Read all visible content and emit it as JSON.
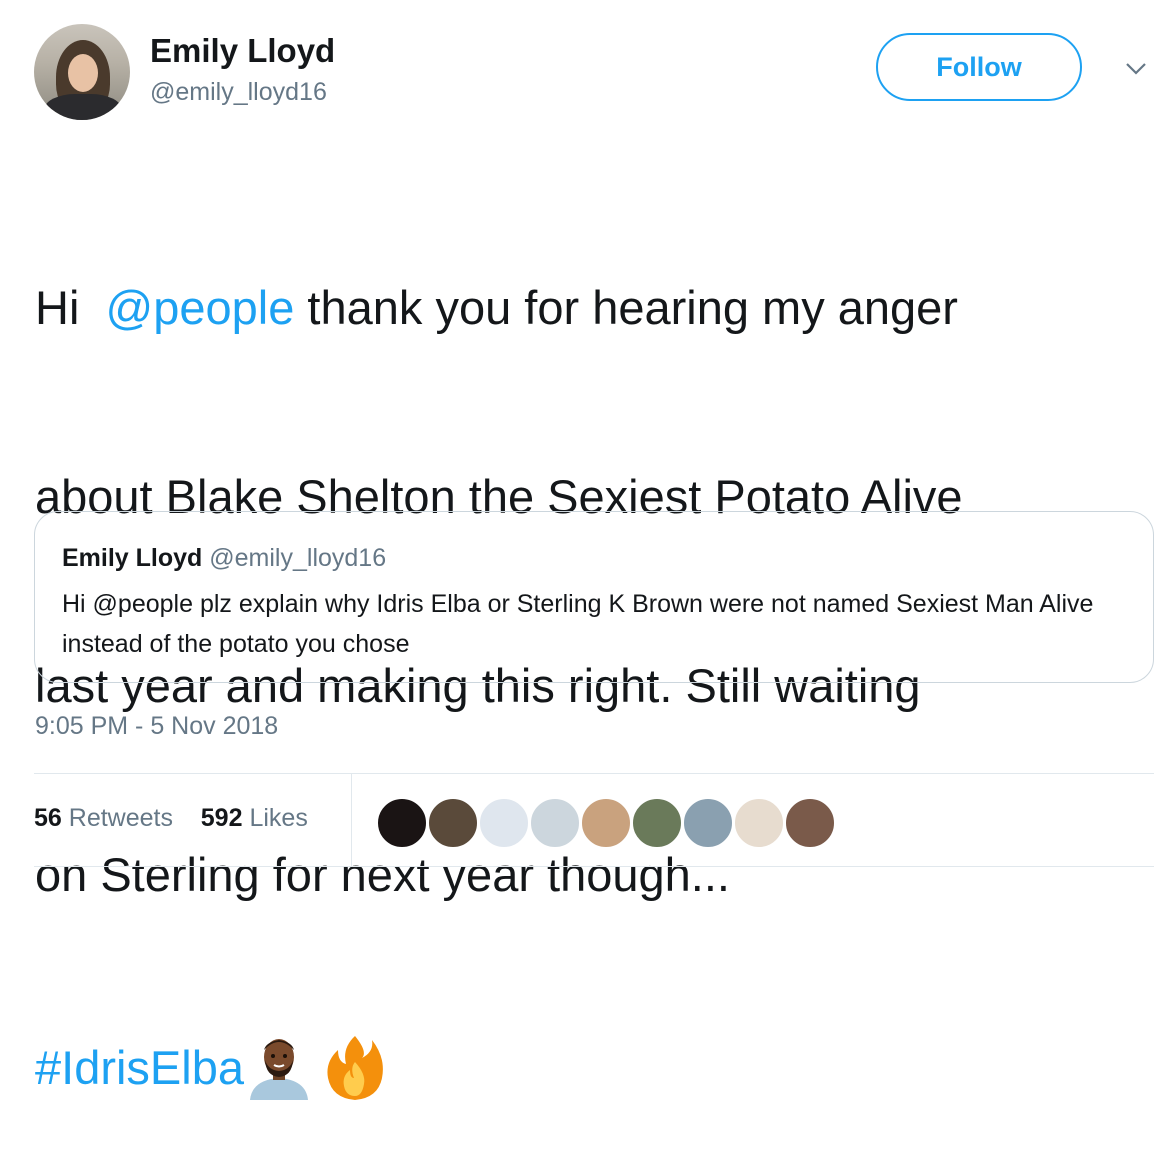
{
  "author": {
    "name": "Emily Lloyd",
    "handle": "@emily_lloyd16",
    "avatar_icon": "profile-photo"
  },
  "actions": {
    "follow_label": "Follow",
    "menu_icon": "chevron-down-icon"
  },
  "tweet": {
    "line1_prefix": "Hi  ",
    "mention": "@people",
    "line1_rest": " thank you for hearing my anger",
    "line2": "about Blake Shelton the Sexiest Potato Alive",
    "line3": "last year and making this right. Still waiting",
    "line4": "on Sterling for next year though...",
    "hashtag": "#IdrisElba",
    "emojis": [
      "man-emoji",
      "fire-emoji"
    ]
  },
  "quoted_tweet": {
    "name": "Emily Lloyd",
    "handle": "@emily_lloyd16",
    "text": "Hi @people plz explain why Idris Elba or Sterling K Brown were not named Sexiest Man Alive instead of the potato you chose"
  },
  "timestamp": "9:05 PM - 5 Nov 2018",
  "stats": {
    "retweets_count": "56",
    "retweets_label": "Retweets",
    "likes_count": "592",
    "likes_label": "Likes"
  },
  "likers": [
    "#1a1414",
    "#5a4a3a",
    "#dfe6ee",
    "#ccd6dd",
    "#c9a27e",
    "#6a7a5a",
    "#8aa0b0",
    "#e7dccf",
    "#7a5a4a"
  ],
  "colors": {
    "accent": "#1da1f2",
    "text": "#14171a",
    "secondary": "#657786",
    "border": "#ccd6dd"
  }
}
